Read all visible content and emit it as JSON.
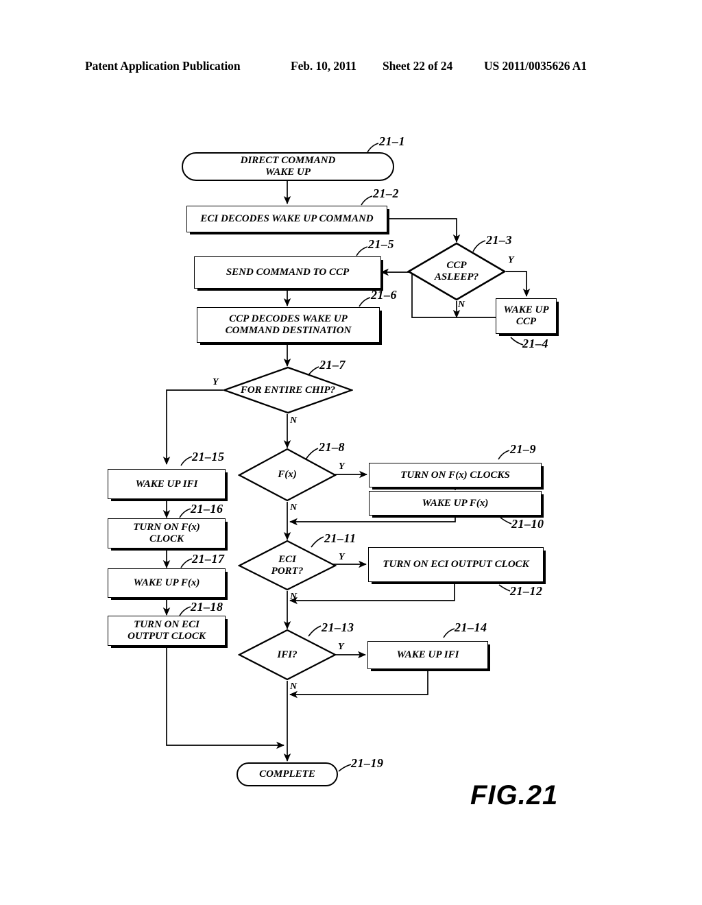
{
  "header": {
    "publication": "Patent Application Publication",
    "date": "Feb. 10, 2011",
    "sheet": "Sheet 22 of 24",
    "patent_number": "US 2011/0035626 A1"
  },
  "figure": {
    "caption": "FIG.21",
    "nodes": [
      {
        "id": "21-1",
        "ref": "21–1",
        "type": "terminal",
        "text": "DIRECT COMMAND\nWAKE UP"
      },
      {
        "id": "21-2",
        "ref": "21–2",
        "type": "process",
        "text": "ECI DECODES WAKE UP COMMAND"
      },
      {
        "id": "21-3",
        "ref": "21–3",
        "type": "decision",
        "text": "CCP\nASLEEP?"
      },
      {
        "id": "21-4",
        "ref": "21–4",
        "type": "process",
        "text": "WAKE UP\nCCP"
      },
      {
        "id": "21-5",
        "ref": "21–5",
        "type": "process",
        "text": "SEND COMMAND TO CCP"
      },
      {
        "id": "21-6",
        "ref": "21–6",
        "type": "process",
        "text": "CCP DECODES WAKE UP\nCOMMAND DESTINATION"
      },
      {
        "id": "21-7",
        "ref": "21–7",
        "type": "decision",
        "text": "FOR ENTIRE CHIP?"
      },
      {
        "id": "21-8",
        "ref": "21–8",
        "type": "decision",
        "text": "F(x)"
      },
      {
        "id": "21-9",
        "ref": "21–9",
        "type": "process",
        "text": "TURN ON F(x) CLOCKS"
      },
      {
        "id": "21-10",
        "ref": "21–10",
        "type": "process",
        "text": "WAKE UP F(x)"
      },
      {
        "id": "21-11",
        "ref": "21–11",
        "type": "decision",
        "text": "ECI\nPORT?"
      },
      {
        "id": "21-12",
        "ref": "21–12",
        "type": "process",
        "text": "TURN ON ECI OUTPUT CLOCK"
      },
      {
        "id": "21-13",
        "ref": "21–13",
        "type": "decision",
        "text": "IFI?"
      },
      {
        "id": "21-14",
        "ref": "21–14",
        "type": "process",
        "text": "WAKE UP IFI"
      },
      {
        "id": "21-15",
        "ref": "21–15",
        "type": "process",
        "text": "WAKE UP IFI"
      },
      {
        "id": "21-16",
        "ref": "21–16",
        "type": "process",
        "text": "TURN ON F(x)\nCLOCK"
      },
      {
        "id": "21-17",
        "ref": "21–17",
        "type": "process",
        "text": "WAKE UP F(x)"
      },
      {
        "id": "21-18",
        "ref": "21–18",
        "type": "process",
        "text": "TURN ON ECI\nOUTPUT CLOCK"
      },
      {
        "id": "21-19",
        "ref": "21–19",
        "type": "terminal",
        "text": "COMPLETE"
      }
    ],
    "branch_labels": {
      "ccp_asleep_yes": "Y",
      "ccp_asleep_no": "N",
      "entire_chip_yes": "Y",
      "entire_chip_no": "N",
      "fx_yes": "Y",
      "fx_no": "N",
      "eci_port_yes": "Y",
      "eci_port_no": "N",
      "ifi_yes": "Y",
      "ifi_no": "N"
    }
  }
}
